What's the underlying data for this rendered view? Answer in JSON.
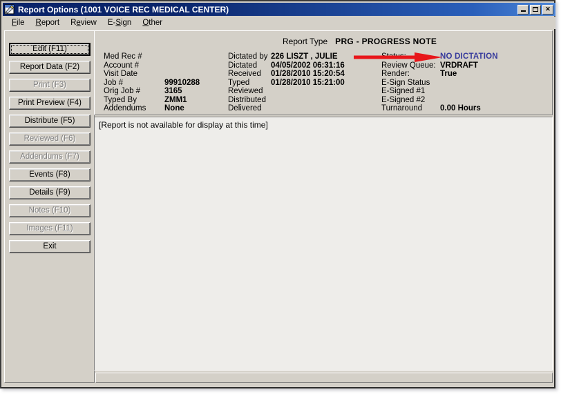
{
  "window": {
    "title": "Report Options  (1001 VOICE REC MEDICAL CENTER)",
    "icon": "report-document-pencil-icon",
    "controls": {
      "minimize": "Minimize",
      "maximize": "Maximize",
      "close": "Close",
      "close_glyph": "✕"
    }
  },
  "menubar": {
    "items": [
      {
        "label": "File",
        "accel": "F",
        "rest": "ile"
      },
      {
        "label": "Report",
        "accel": "R",
        "rest": "eport"
      },
      {
        "label": "Review",
        "accel": "R",
        "rest": "eview",
        "pre": "",
        "mid": ""
      },
      {
        "label": "E-Sign",
        "accel": "S",
        "pre": "E-",
        "rest": "ign"
      },
      {
        "label": "Other",
        "accel": "O",
        "rest": "ther"
      }
    ]
  },
  "sidebar": {
    "buttons": [
      {
        "label": "Edit (F11)",
        "enabled": true,
        "default": true
      },
      {
        "label": "Report Data (F2)",
        "enabled": true,
        "default": false
      },
      {
        "label": "Print (F3)",
        "enabled": false,
        "default": false
      },
      {
        "label": "Print Preview (F4)",
        "enabled": true,
        "default": false
      },
      {
        "label": "Distribute (F5)",
        "enabled": true,
        "default": false
      },
      {
        "label": "Reviewed (F6)",
        "enabled": false,
        "default": false
      },
      {
        "label": "Addendums (F7)",
        "enabled": false,
        "default": false
      },
      {
        "label": "Events (F8)",
        "enabled": true,
        "default": false
      },
      {
        "label": "Details (F9)",
        "enabled": true,
        "default": false
      },
      {
        "label": "Notes (F10)",
        "enabled": false,
        "default": false
      },
      {
        "label": "Images (F11)",
        "enabled": false,
        "default": false
      },
      {
        "label": "Exit",
        "enabled": true,
        "default": false
      }
    ]
  },
  "info_panel": {
    "report_type_label": "Report Type",
    "report_type_value": "PRG - PROGRESS NOTE",
    "column1": [
      {
        "label": "Med Rec #",
        "value": ""
      },
      {
        "label": "Account #",
        "value": ""
      },
      {
        "label": "Visit Date",
        "value": ""
      },
      {
        "label": "Job #",
        "value": "99910288"
      },
      {
        "label": "Orig Job #",
        "value": "3165"
      },
      {
        "label": "Typed By",
        "value": "ZMM1"
      },
      {
        "label": "Addendums",
        "value": "None"
      }
    ],
    "column2": [
      {
        "label": "Dictated by",
        "value": "226 LISZT , JULIE"
      },
      {
        "label": "Dictated",
        "value": "04/05/2002  06:31:16"
      },
      {
        "label": "Received",
        "value": "01/28/2010  15:20:54"
      },
      {
        "label": "Typed",
        "value": "01/28/2010  15:21:00"
      },
      {
        "label": "Reviewed",
        "value": ""
      },
      {
        "label": "Distributed",
        "value": ""
      },
      {
        "label": "Delivered",
        "value": ""
      }
    ],
    "column3": [
      {
        "label": "Status:",
        "value": "NO DICTATION",
        "highlight": true
      },
      {
        "label": "Review Queue:",
        "value": "VRDRAFT",
        "highlight": false
      },
      {
        "label": "Render:",
        "value": "True",
        "highlight": false
      },
      {
        "label": "E-Sign Status",
        "value": "",
        "highlight": false
      },
      {
        "label": "E-Signed #1",
        "value": "",
        "highlight": false
      },
      {
        "label": "E-Signed #2",
        "value": "",
        "highlight": false
      },
      {
        "label": "Turnaround",
        "value": "0.00 Hours",
        "highlight": false
      }
    ],
    "annotation": {
      "type": "red-arrow",
      "points_to": "NO DICTATION",
      "color": "#e8161a"
    }
  },
  "document": {
    "body_text": "[Report is not available for display at this time]"
  },
  "colors": {
    "title_bar_start": "#0a246a",
    "title_bar_end": "#4d87d8",
    "face": "#d4d0c8",
    "document_bg": "#eeedea",
    "status_highlight": "#363a9c",
    "arrow": "#e8161a"
  },
  "statusbar": {
    "text": ""
  }
}
